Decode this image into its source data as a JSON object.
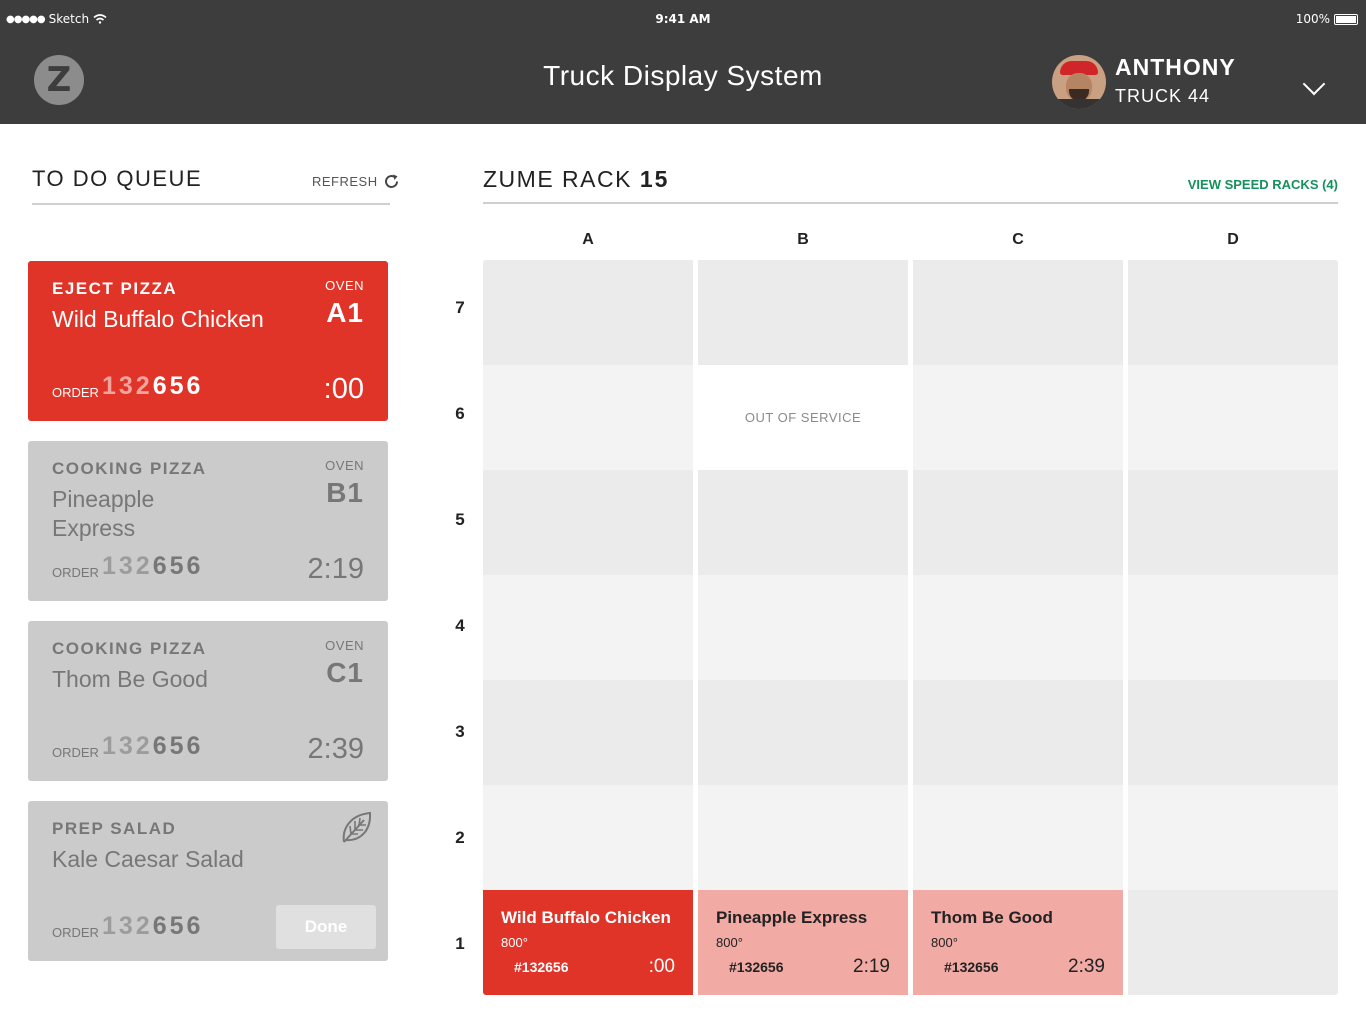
{
  "status_bar": {
    "carrier": "Sketch",
    "signal_dots": "●●●●●",
    "time": "9:41 AM",
    "battery": "100%"
  },
  "header": {
    "logo_letter": "Z",
    "title": "Truck Display System",
    "user_name": "ANTHONY",
    "user_truck": "TRUCK 44"
  },
  "queue": {
    "title": "TO DO QUEUE",
    "refresh_label": "REFRESH",
    "order_label": "ORDER",
    "oven_label": "OVEN",
    "done_label": "Done",
    "cards": [
      {
        "type": "EJECT PIZZA",
        "name": "Wild Buffalo Chicken",
        "oven": "A1",
        "order_prefix": "132",
        "order_suffix": "656",
        "timer": ":00"
      },
      {
        "type": "COOKING PIZZA",
        "name": "Pineapple Express",
        "oven": "B1",
        "order_prefix": "132",
        "order_suffix": "656",
        "timer": "2:19"
      },
      {
        "type": "COOKING PIZZA",
        "name": "Thom Be Good",
        "oven": "C1",
        "order_prefix": "132",
        "order_suffix": "656",
        "timer": "2:39"
      },
      {
        "type": "PREP SALAD",
        "name": "Kale Caesar Salad",
        "order_prefix": "132",
        "order_suffix": "656"
      }
    ]
  },
  "rack": {
    "title_prefix": "ZUME RACK",
    "number": "15",
    "speed_racks_link": "VIEW SPEED RACKS (4)",
    "columns": [
      "A",
      "B",
      "C",
      "D"
    ],
    "rows": [
      "7",
      "6",
      "5",
      "4",
      "3",
      "2",
      "1"
    ],
    "out_of_service": "OUT OF SERVICE",
    "slots": [
      {
        "name": "Wild Buffalo Chicken",
        "temp": "800°",
        "order": "#132656",
        "timer": ":00"
      },
      {
        "name": "Pineapple Express",
        "temp": "800°",
        "order": "#132656",
        "timer": "2:19"
      },
      {
        "name": "Thom Be Good",
        "temp": "800°",
        "order": "#132656",
        "timer": "2:39"
      }
    ]
  },
  "colors": {
    "header_bg": "#3d3d3d",
    "active_red": "#e03428",
    "pending_pink": "#f1aaa4",
    "link_green": "#16905f",
    "card_gray": "#cbcbcb"
  }
}
